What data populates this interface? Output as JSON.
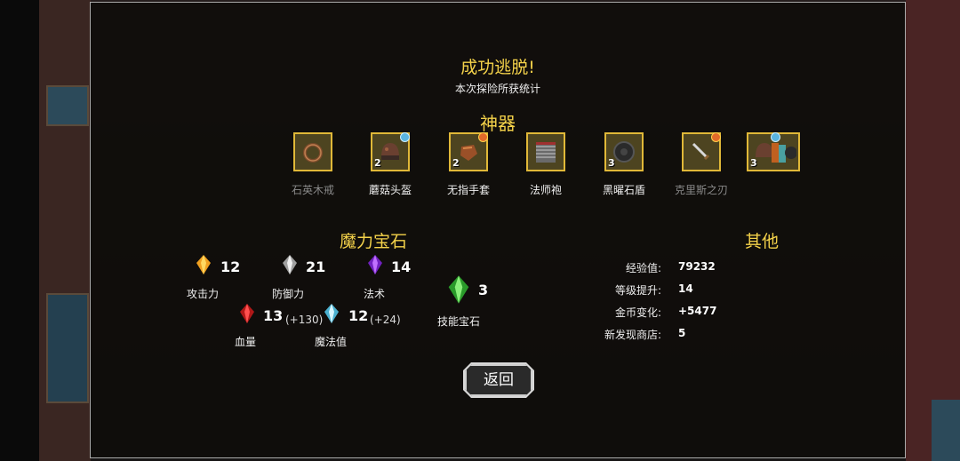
{
  "dialog": {
    "title": "成功逃脱!",
    "subtitle": "本次探险所获统计",
    "back_label": "返回"
  },
  "artifacts": {
    "heading": "神器",
    "items": [
      {
        "name": "石英木戒",
        "count": "",
        "dim": true,
        "icon": "ring-icon",
        "badge": ""
      },
      {
        "name": "蘑菇头盔",
        "count": "2",
        "dim": false,
        "icon": "helmet-icon",
        "badge": "blue"
      },
      {
        "name": "无指手套",
        "count": "2",
        "dim": false,
        "icon": "glove-icon",
        "badge": "orange"
      },
      {
        "name": "法师袍",
        "count": "",
        "dim": false,
        "icon": "robe-icon",
        "badge": ""
      },
      {
        "name": "黑曜石盾",
        "count": "3",
        "dim": false,
        "icon": "shield-icon",
        "badge": ""
      },
      {
        "name": "克里斯之刃",
        "count": "",
        "dim": true,
        "icon": "dagger-icon",
        "badge": "orange"
      },
      {
        "name": "",
        "count": "3",
        "dim": false,
        "icon": "stacked-items-icon",
        "badge": "blue"
      }
    ]
  },
  "gems": {
    "heading": "魔力宝石",
    "attack": {
      "label": "攻击力",
      "value": "12",
      "color": "#f0a020",
      "icon": "yellow-gem-icon"
    },
    "defense": {
      "label": "防御力",
      "value": "21",
      "color": "#c8c8c8",
      "icon": "white-gem-icon"
    },
    "magic": {
      "label": "法术",
      "value": "14",
      "color": "#9b3fe0",
      "icon": "purple-gem-icon"
    },
    "hp": {
      "label": "血量",
      "value": "13",
      "bonus": "(+130)",
      "color": "#e02a2a",
      "icon": "red-gem-icon"
    },
    "mana": {
      "label": "魔法值",
      "value": "12",
      "bonus": "(+24)",
      "color": "#8fd8f0",
      "icon": "cyan-gem-icon"
    },
    "skill": {
      "label": "技能宝石",
      "value": "3",
      "color": "#5ad04a",
      "icon": "green-gem-icon"
    }
  },
  "other": {
    "heading": "其他",
    "stats": [
      {
        "label": "经验值:",
        "value": "79232"
      },
      {
        "label": "等级提升:",
        "value": "14"
      },
      {
        "label": "金币变化:",
        "value": "+5477"
      },
      {
        "label": "新发现商店:",
        "value": "5"
      }
    ]
  },
  "colors": {
    "accent": "#f4d24a",
    "slot_border": "#e0b838"
  }
}
